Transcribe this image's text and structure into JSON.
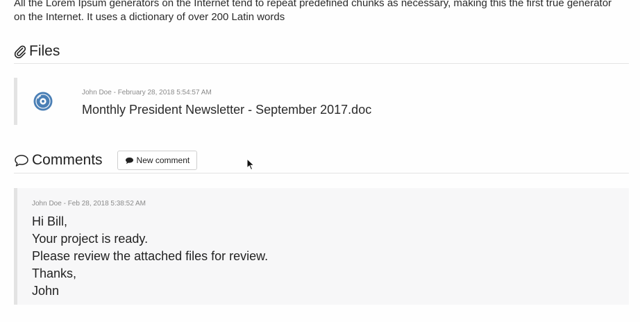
{
  "intro": {
    "text": "All the Lorem Ipsum generators on the Internet tend to repeat predefined chunks as necessary, making this the first true generator on the Internet. It uses a dictionary of over 200 Latin words"
  },
  "files": {
    "heading": "Files",
    "icon": "paperclip-icon",
    "items": [
      {
        "meta": "John Doe - February 28, 2018 5:54:57 AM",
        "name": "Monthly President Newsletter - September 2017.doc",
        "icon": "disc-icon",
        "icon_color": "#4a7fb5"
      }
    ]
  },
  "comments": {
    "heading": "Comments",
    "icon": "speech-bubble-icon",
    "new_comment_label": "New comment",
    "items": [
      {
        "meta": "John Doe - Feb 28, 2018 5:38:52 AM",
        "lines": [
          "Hi Bill,",
          "Your project is ready.",
          "Please review the attached files for review.",
          "Thanks,",
          "John"
        ]
      }
    ]
  }
}
